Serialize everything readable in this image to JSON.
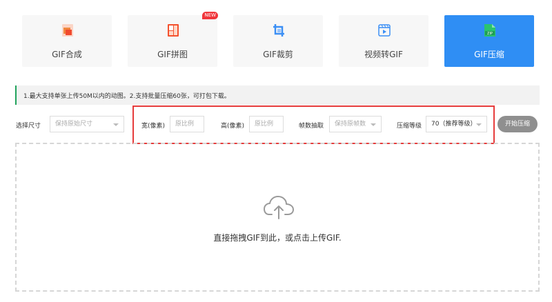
{
  "tools": [
    {
      "label": "GIF合成",
      "icon": "gif-compose-icon",
      "color": "#f26b3a"
    },
    {
      "label": "GIF拼图",
      "icon": "gif-puzzle-icon",
      "color": "#f26b3a",
      "badge": "NEW"
    },
    {
      "label": "GIF裁剪",
      "icon": "crop-icon",
      "color": "#3b8ff5"
    },
    {
      "label": "视频转GIF",
      "icon": "video-icon",
      "color": "#3b8ff5"
    },
    {
      "label": "GIF压缩",
      "icon": "zip-file-icon",
      "color": "#2bc46d",
      "active": true
    }
  ],
  "notice": "1.最大支持单张上传50M以内的动图。2.支持批量压缩60张，可打包下载。",
  "options": {
    "size_label": "选择尺寸",
    "size_value": "保持原始尺寸",
    "width_label": "宽(像素)",
    "width_placeholder": "原比例",
    "height_label": "高(像素)",
    "height_placeholder": "原比例",
    "frame_label": "帧数抽取",
    "frame_value": "保持原帧数",
    "quality_label": "压缩等级",
    "quality_value": "70（推荐等级）"
  },
  "start_label": "开始压缩",
  "drop_text": "直接拖拽GIF到此，或点击上传GIF.",
  "colors": {
    "accent": "#2f8ef4",
    "highlight": "#e63b3b",
    "notice_border": "#21a35c"
  }
}
